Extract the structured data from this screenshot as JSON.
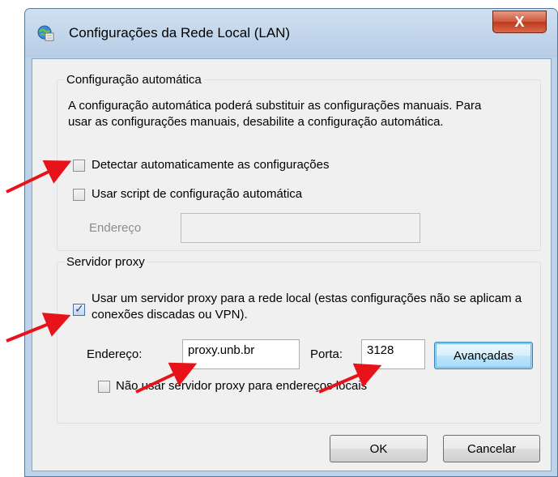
{
  "window": {
    "title": "Configurações da Rede Local (LAN)",
    "close_label": "X"
  },
  "auto_config": {
    "group_label": "Configuração automática",
    "description": "A configuração automática poderá substituir as configurações manuais. Para usar as configurações manuais, desabilite a configuração automática.",
    "auto_detect": {
      "label": "Detectar automaticamente as configurações",
      "checked": false
    },
    "use_script": {
      "label": "Usar script de configuração automática",
      "checked": false
    },
    "address_label": "Endereço",
    "address_value": ""
  },
  "proxy": {
    "group_label": "Servidor proxy",
    "use_proxy": {
      "label": "Usar um servidor proxy para a rede local (estas configurações não se aplicam a conexões discadas ou VPN).",
      "checked": true
    },
    "address_label": "Endereço:",
    "address_value": "proxy.unb.br",
    "port_label": "Porta:",
    "port_value": "3128",
    "advanced_label": "Avançadas",
    "bypass_local": {
      "label": "Não usar servidor proxy para endereços locais",
      "checked": false
    }
  },
  "buttons": {
    "ok_label": "OK",
    "cancel_label": "Cancelar"
  },
  "annotation_color": "#e8121a"
}
